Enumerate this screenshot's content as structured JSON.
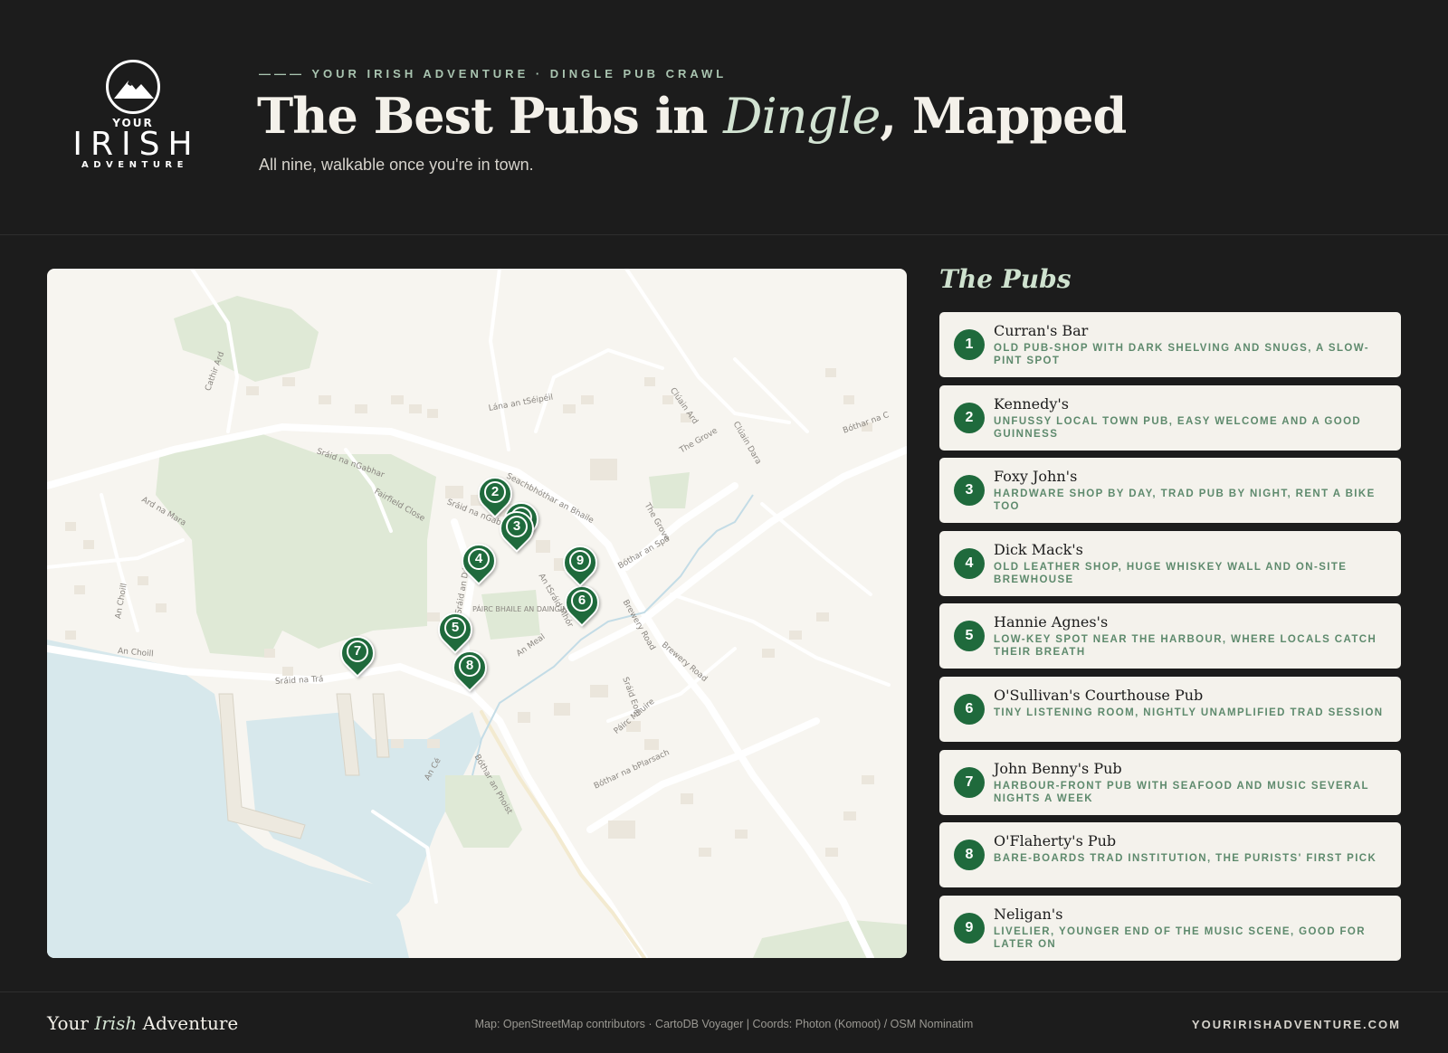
{
  "header": {
    "logo": {
      "line1": "YOUR",
      "line2": "IRISH",
      "line3": "ADVENTURE"
    },
    "kicker": "——— YOUR IRISH ADVENTURE · DINGLE PUB CRAWL",
    "title_pre": "The Best Pubs in ",
    "title_em": "Dingle",
    "title_post": ", Mapped",
    "subtitle": "All nine, walkable once you're in town."
  },
  "map": {
    "labels": [
      "Sráid na nGabhar",
      "Seachbhóthar an Bhaile",
      "Sráid na nGabhar",
      "Bóthar an Spá",
      "Bóthar na C",
      "Brewery Road",
      "Brewery Road",
      "An Choill",
      "Sráid na Trá",
      "Bóthar an Phoist",
      "Bóthar na bPlarsach",
      "An Meal",
      "PÁIRC BHAILE AN DAINGIN",
      "Lána an tSéipéil",
      "Ard na Mara",
      "Cathir Ard",
      "Clúain Ard",
      "Clúain Dara",
      "The Grove",
      "The Grove",
      "Sráid Eoin",
      "Páirc Mhuire",
      "An Choill",
      "An Cé",
      "Fairfield Close",
      "An tSráid Mhór",
      "Sráid an Dúin"
    ],
    "markers": [
      {
        "num": "1",
        "name": "Curran's Bar"
      },
      {
        "num": "2",
        "name": "Kennedy's"
      },
      {
        "num": "3",
        "name": "Foxy John's"
      },
      {
        "num": "4",
        "name": "Dick Mack's"
      },
      {
        "num": "5",
        "name": "Hannie Agnes's"
      },
      {
        "num": "6",
        "name": "O'Sullivan's Courthouse Pub"
      },
      {
        "num": "7",
        "name": "John Benny's Pub"
      },
      {
        "num": "8",
        "name": "O'Flaherty's Pub"
      },
      {
        "num": "9",
        "name": "Neligan's"
      }
    ]
  },
  "list": {
    "title": "The Pubs",
    "items": [
      {
        "num": "1",
        "name": "Curran's Bar",
        "desc": "Old pub-shop with dark shelving and snugs, a slow-pint spot"
      },
      {
        "num": "2",
        "name": "Kennedy's",
        "desc": "Unfussy local town pub, easy welcome and a good Guinness"
      },
      {
        "num": "3",
        "name": "Foxy John's",
        "desc": "Hardware shop by day, trad pub by night, rent a bike too"
      },
      {
        "num": "4",
        "name": "Dick Mack's",
        "desc": "Old leather shop, huge whiskey wall and on-site brewhouse"
      },
      {
        "num": "5",
        "name": "Hannie Agnes's",
        "desc": "Low-key spot near the harbour, where locals catch their breath"
      },
      {
        "num": "6",
        "name": "O'Sullivan's Courthouse Pub",
        "desc": "Tiny listening room, nightly unamplified trad session"
      },
      {
        "num": "7",
        "name": "John Benny's Pub",
        "desc": "Harbour-front pub with seafood and music several nights a week"
      },
      {
        "num": "8",
        "name": "O'Flaherty's Pub",
        "desc": "Bare-boards trad institution, the purists' first pick"
      },
      {
        "num": "9",
        "name": "Neligan's",
        "desc": "Livelier, younger end of the music scene, good for later on"
      }
    ]
  },
  "footer": {
    "brand_pre": "Your ",
    "brand_em": "Irish",
    "brand_post": " Adventure",
    "credit": "Map: OpenStreetMap contributors · CartoDB Voyager | Coords: Photon (Komoot) / OSM Nominatim",
    "url": "YOURIRISHADVENTURE.COM"
  },
  "colors": {
    "accent_green": "#1f6a3c",
    "background": "#1c1c1c",
    "card": "#f4f2ec",
    "sea": "#d7e8ec",
    "park": "#dfe9d6"
  }
}
